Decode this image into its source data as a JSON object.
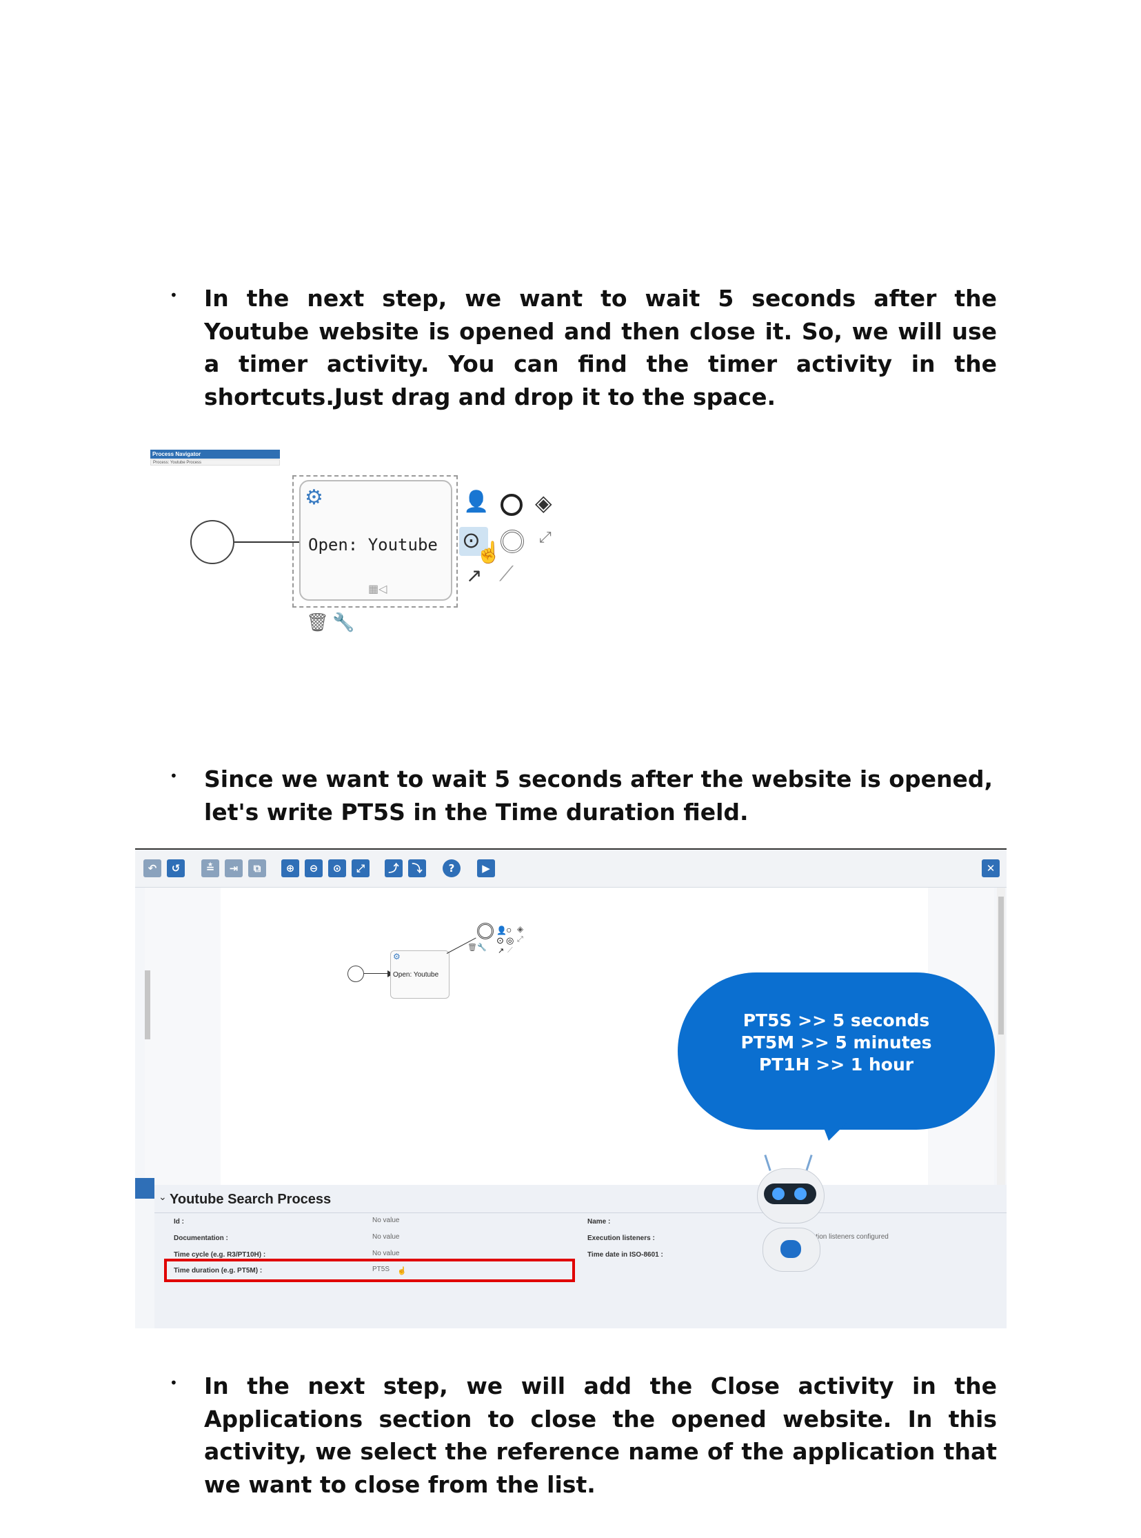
{
  "paragraphs": {
    "p1": "In the next step, we want to wait 5 seconds after the Youtube website is opened and then close it. So, we will use a timer activity. You can find the timer activity in the shortcuts.Just drag and drop it to the space.",
    "p2": "Since we want to wait 5 seconds after the website is opened, let's write PT5S in the Time duration field.",
    "p3": "In the next step, we will add the Close activity in the Applications section to close the opened website. In this activity, we select the reference name of the application that we want to close from the list."
  },
  "bullet_char": "•",
  "figure1": {
    "navigator_title": "Process Navigator",
    "navigator_sub": "Process: Youtube Process",
    "task_label": "Open: Youtube",
    "icons": [
      "gear-icon",
      "user-task-icon",
      "end-event-icon",
      "gateway-icon",
      "timer-event-icon",
      "intermediate-event-icon",
      "annotation-icon",
      "connector-icon",
      "association-icon",
      "trash-icon",
      "wrench-icon"
    ]
  },
  "figure2": {
    "toolbar_icons": [
      "undo-icon",
      "redo-icon",
      "align-icon",
      "distribute-icon",
      "group-icon",
      "zoom-in-icon",
      "zoom-out-icon",
      "zoom-fit-icon",
      "fullscreen-icon",
      "docker-add-icon",
      "docker-remove-icon",
      "help-icon",
      "run-icon",
      "close-icon"
    ],
    "task_label": "Open: Youtube",
    "bubble_lines": [
      "PT5S >> 5 seconds",
      "PT5M >> 5 minutes",
      "PT1H >> 1 hour"
    ],
    "process_title": "Youtube Search Process",
    "properties": {
      "id_label": "Id :",
      "id_value": "No value",
      "doc_label": "Documentation :",
      "doc_value": "No value",
      "cycle_label": "Time cycle (e.g. R3/PT10H) :",
      "cycle_value": "No value",
      "duration_label": "Time duration (e.g. PT5M) :",
      "duration_value": "PT5S",
      "name_label": "Name :",
      "exec_label": "Execution listeners :",
      "exec_value": "No execution listeners configured",
      "date_label": "Time date in ISO-8601 :"
    },
    "colors": {
      "accent": "#2f6fb7",
      "bubble": "#0b6fd0",
      "highlight": "#e00000"
    }
  }
}
